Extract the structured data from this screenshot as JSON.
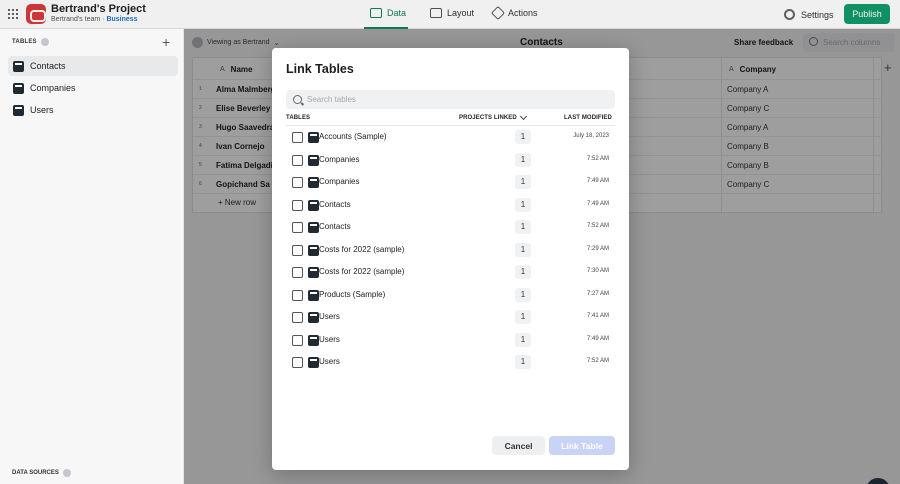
{
  "app": {
    "project_name": "Bertrand's Project",
    "team": "Bertrand's team",
    "separator": " · ",
    "plan": "Business"
  },
  "nav": {
    "data": "Data",
    "layout": "Layout",
    "actions": "Actions",
    "settings": "Settings",
    "publish": "Publish"
  },
  "sidebar": {
    "tables_title": "TABLES",
    "items": [
      {
        "label": "Contacts"
      },
      {
        "label": "Companies"
      },
      {
        "label": "Users"
      }
    ],
    "data_sources_title": "DATA SOURCES"
  },
  "main": {
    "viewing_as": "Viewing as Bertrand",
    "title": "Contacts",
    "share_feedback": "Share feedback",
    "search_placeholder": "Search columns",
    "columns": {
      "name": "Name",
      "company": "Company",
      "type_glyph": "A"
    },
    "rows": [
      {
        "num": "1",
        "name": "Alma Malmberg",
        "company": "Company A"
      },
      {
        "num": "2",
        "name": "Elise Beverley",
        "company": "Company C"
      },
      {
        "num": "3",
        "name": "Hugo Saavedra",
        "company": "Company A"
      },
      {
        "num": "4",
        "name": "Ivan Cornejo",
        "company": "Company B"
      },
      {
        "num": "5",
        "name": "Fatima Delgadi",
        "company": "Company B"
      },
      {
        "num": "6",
        "name": "Gopichand Sa",
        "company": "Company C"
      }
    ],
    "new_row": "New row"
  },
  "modal": {
    "title": "Link Tables",
    "search_placeholder": "Search tables",
    "headers": {
      "tables": "TABLES",
      "projects_linked": "PROJECTS LINKED",
      "last_modified": "LAST MODIFIED"
    },
    "rows": [
      {
        "name": "Accounts (Sample)",
        "count": "1",
        "modified": "July 18, 2023"
      },
      {
        "name": "Companies",
        "count": "1",
        "modified": "7:52 AM"
      },
      {
        "name": "Companies",
        "count": "1",
        "modified": "7:49 AM"
      },
      {
        "name": "Contacts",
        "count": "1",
        "modified": "7:49 AM"
      },
      {
        "name": "Contacts",
        "count": "1",
        "modified": "7:52 AM"
      },
      {
        "name": "Costs for 2022 (sample)",
        "count": "1",
        "modified": "7:29 AM"
      },
      {
        "name": "Costs for 2022 (sample)",
        "count": "1",
        "modified": "7:30 AM"
      },
      {
        "name": "Products (Sample)",
        "count": "1",
        "modified": "7:27 AM"
      },
      {
        "name": "Users",
        "count": "1",
        "modified": "7:41 AM"
      },
      {
        "name": "Users",
        "count": "1",
        "modified": "7:49 AM"
      },
      {
        "name": "Users",
        "count": "1",
        "modified": "7:52 AM"
      }
    ],
    "cancel": "Cancel",
    "link_table": "Link Table"
  },
  "colors": {
    "accent_green": "#129b6b",
    "brand_red": "#d93a3a",
    "link_disabled": "#c9d3f5"
  }
}
